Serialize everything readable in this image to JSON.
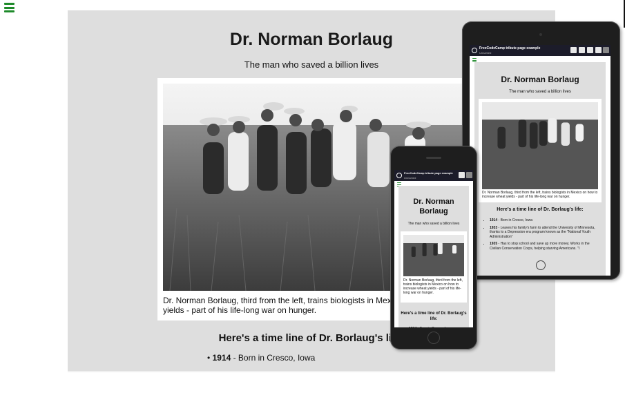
{
  "page": {
    "title": "Dr. Norman Borlaug",
    "subtitle": "The man who saved a billion lives",
    "caption": "Dr. Norman Borlaug, third from the left, trains biologists in Mexico on how to increase wheat yields - part of his life-long war on hunger.",
    "caption_cropped": "Dr. Norman Borlaug, third from the left, trains biologists in Mexico on h wheat yields - part of his life-long war on hunger.",
    "timeline_heading": "Here's a time line of Dr. Borlaug's life:",
    "timeline": [
      {
        "year": "1914",
        "text": " - Born in Cresco, Iowa"
      },
      {
        "year": "1933",
        "text": " - Leaves his family's farm to attend the University of Minnesota, thanks to a Depression era program known as the \"National Youth Administration\""
      },
      {
        "year": "1935",
        "text": " - Has to stop school and save up more money. Works in the Civilian Conservation Corps, helping starving Americans. \"I"
      }
    ]
  },
  "tablet": {
    "app_title": "FreeCodeCamp tribute page example",
    "app_subtitle": "Unnamed"
  },
  "phone": {
    "app_title": "FreeCodeCamp tribute page example",
    "app_subtitle": "Unnamed"
  },
  "colors": {
    "menu_icon": "#1e8a2a",
    "page_bg": "#dedede",
    "device_frame": "#1e1e1e"
  },
  "icons": [
    "menu-icon",
    "freecodecamp-logo",
    "heart-icon",
    "list-icon",
    "arrow-icon",
    "chevron-icon"
  ]
}
